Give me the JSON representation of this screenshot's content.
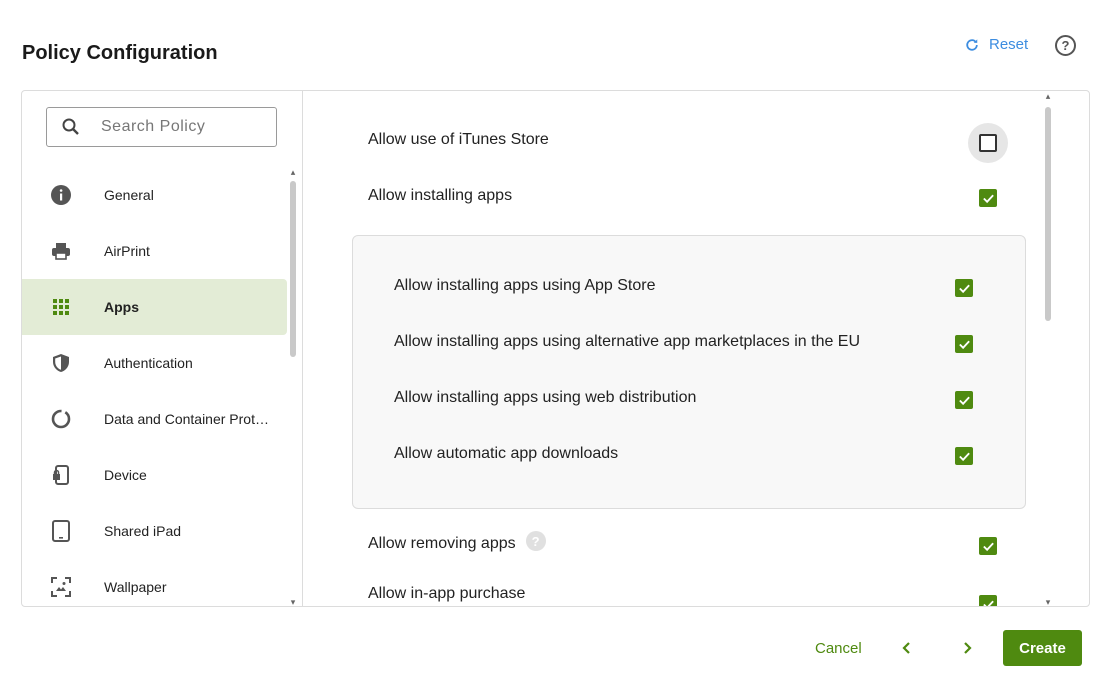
{
  "header": {
    "title": "Policy Configuration",
    "reset_label": "Reset",
    "help_symbol": "?"
  },
  "sidebar": {
    "search_placeholder": "Search Policy",
    "items": [
      {
        "label": "General",
        "icon": "info-icon"
      },
      {
        "label": "AirPrint",
        "icon": "printer-icon"
      },
      {
        "label": "Apps",
        "icon": "apps-grid-icon",
        "active": true
      },
      {
        "label": "Authentication",
        "icon": "shield-icon"
      },
      {
        "label": "Data and Container Protection",
        "icon": "circular-progress-icon"
      },
      {
        "label": "Device",
        "icon": "device-lock-icon"
      },
      {
        "label": "Shared iPad",
        "icon": "tablet-icon"
      },
      {
        "label": "Wallpaper",
        "icon": "wallpaper-icon"
      }
    ]
  },
  "content": {
    "itunes_label": "Allow use of iTunes Store",
    "itunes_checked": false,
    "installing_label": "Allow installing apps",
    "installing_checked": true,
    "sub_options": [
      {
        "label": "Allow installing apps using App Store",
        "checked": true
      },
      {
        "label": "Allow installing apps using alternative app marketplaces in the EU",
        "checked": true
      },
      {
        "label": "Allow installing apps using web distribution",
        "checked": true
      },
      {
        "label": "Allow automatic app downloads",
        "checked": true
      }
    ],
    "removing_label": "Allow removing apps",
    "removing_checked": true,
    "removing_help": "?",
    "inapp_label": "Allow in-app purchase",
    "inapp_checked": true
  },
  "footer": {
    "cancel_label": "Cancel",
    "create_label": "Create"
  },
  "colors": {
    "accent": "#4f8a10",
    "link": "#3d8de0",
    "active_bg": "#e3ecd6",
    "callout_arrow": "#f29b17"
  }
}
